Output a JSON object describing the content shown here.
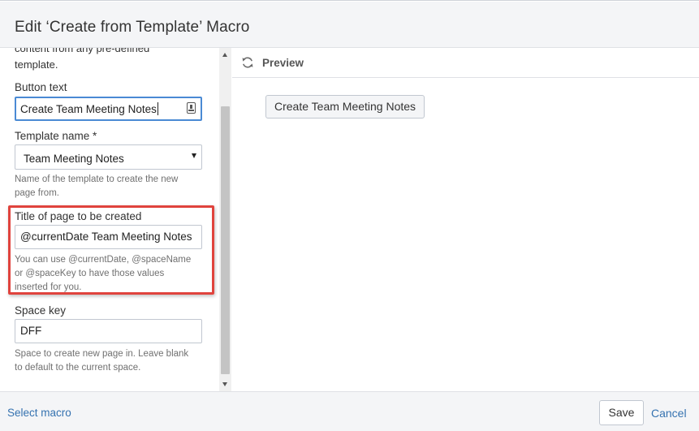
{
  "dialog": {
    "title": "Edit ‘Create from Template’ Macro"
  },
  "params": {
    "description_tail_1": "content from any pre-defined",
    "description_tail_2": "template.",
    "button_text": {
      "label": "Button text",
      "value": "Create Team Meeting Notes"
    },
    "template_name": {
      "label": "Template name *",
      "selected": "Team Meeting Notes",
      "help_1": "Name of the template to create the new",
      "help_2": "page from."
    },
    "title_of_page": {
      "label": "Title of page to be created",
      "value": "@currentDate Team Meeting Notes",
      "help_1": "You can use @currentDate, @spaceName",
      "help_2": "or @spaceKey to have those values",
      "help_3": "inserted for you."
    },
    "space_key": {
      "label": "Space key",
      "value": "DFF",
      "help_1": "Space to create new page in. Leave blank",
      "help_2": "to default to the current space."
    }
  },
  "preview": {
    "label": "Preview",
    "button_label": "Create Team Meeting Notes"
  },
  "footer": {
    "select_macro": "Select macro",
    "save": "Save",
    "cancel": "Cancel"
  },
  "colors": {
    "highlight": "#e0433d",
    "link": "#3572b0",
    "focus": "#4a8ad4"
  },
  "icons": {
    "refresh": "refresh-icon",
    "field_assist": "field-assist-icon",
    "dropdown": "chevron-down-icon"
  }
}
